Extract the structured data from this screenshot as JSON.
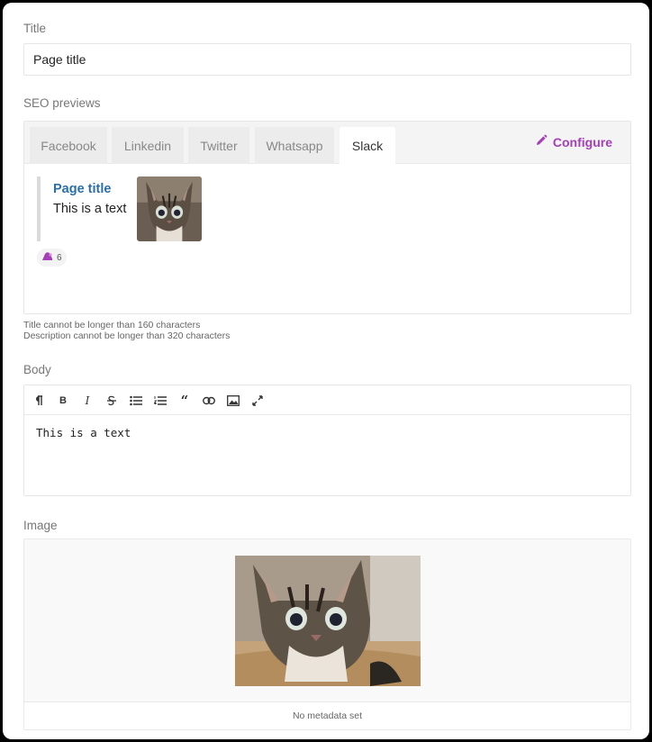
{
  "title_field": {
    "label": "Title",
    "value": "Page title"
  },
  "seo": {
    "label": "SEO previews",
    "tabs": [
      {
        "label": "Facebook"
      },
      {
        "label": "Linkedin"
      },
      {
        "label": "Twitter"
      },
      {
        "label": "Whatsapp"
      },
      {
        "label": "Slack"
      }
    ],
    "active_tab": "Slack",
    "configure_label": "Configure",
    "preview": {
      "title": "Page title",
      "text": "This is a text"
    },
    "reaction_count": "6",
    "hint_title": "Title cannot be longer than 160 characters",
    "hint_description": "Description cannot be longer than 320 characters"
  },
  "body_field": {
    "label": "Body",
    "content": "This is a text"
  },
  "image_field": {
    "label": "Image",
    "metadata_text": "No metadata set"
  },
  "colors": {
    "accent": "#a43fb7",
    "link": "#2a6fa8"
  },
  "icons": [
    "pencil-icon",
    "paragraph-icon",
    "bold-icon",
    "italic-icon",
    "strikethrough-icon",
    "bullet-list-icon",
    "numbered-list-icon",
    "quote-icon",
    "link-icon",
    "image-icon",
    "expand-icon"
  ]
}
